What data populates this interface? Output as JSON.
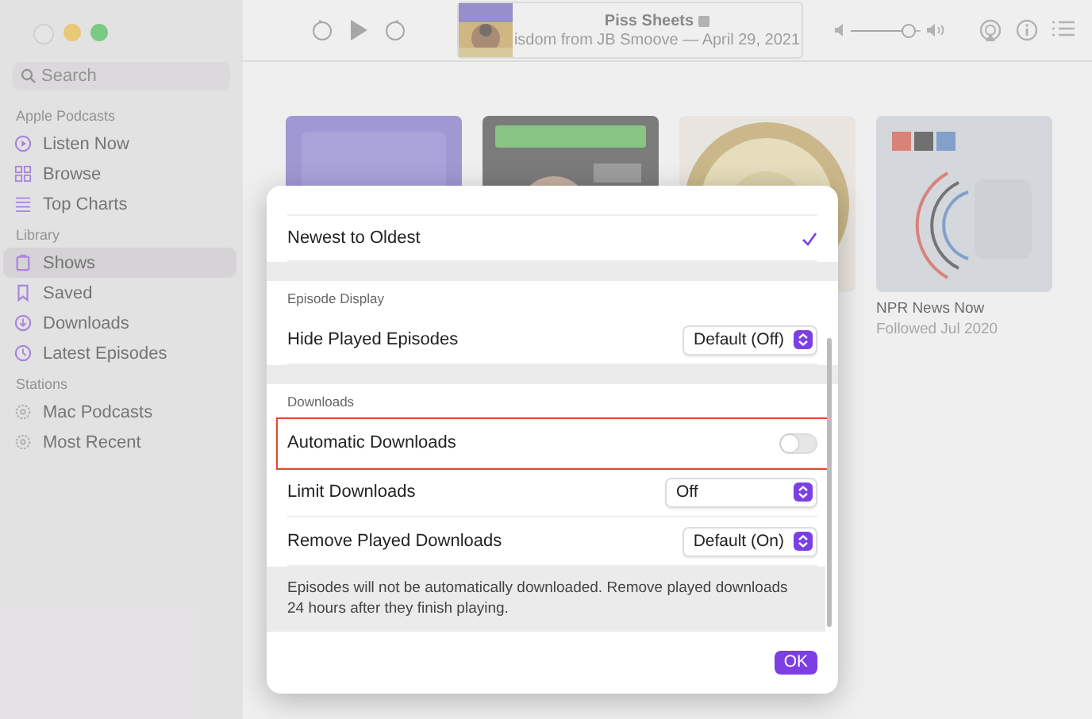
{
  "toolbar": {
    "now_playing": {
      "title": "Piss Sheets",
      "subtitle": "isdom from JB Smoove — April 29, 2021"
    },
    "volume": {
      "level": 0.85
    }
  },
  "sidebar": {
    "search": {
      "placeholder": "Search"
    },
    "sections": [
      {
        "title": "Apple Podcasts",
        "items": [
          {
            "label": "Listen Now",
            "selected": false
          },
          {
            "label": "Browse",
            "selected": false
          },
          {
            "label": "Top Charts",
            "selected": false
          }
        ]
      },
      {
        "title": "Library",
        "items": [
          {
            "label": "Shows",
            "selected": true
          },
          {
            "label": "Saved",
            "selected": false
          },
          {
            "label": "Downloads",
            "selected": false
          },
          {
            "label": "Latest Episodes",
            "selected": false
          }
        ]
      },
      {
        "title": "Stations",
        "items": [
          {
            "label": "Mac Podcasts",
            "selected": false
          },
          {
            "label": "Most Recent",
            "selected": false
          }
        ]
      }
    ]
  },
  "shows": [
    {
      "kind": "picture"
    },
    {
      "kind": "picture"
    },
    {
      "kind": "picture"
    },
    {
      "kind": "picture",
      "title": "NPR News Now",
      "subtitle": "Followed Jul 2020"
    }
  ],
  "dialog": {
    "rows": [
      {
        "kind": "blank"
      },
      {
        "kind": "check",
        "label": "Newest to Oldest",
        "checked": true
      },
      {
        "kind": "gap"
      },
      {
        "kind": "header",
        "label": "Episode Display"
      },
      {
        "kind": "popup",
        "label": "Hide Played Episodes",
        "value": "Default (Off)"
      },
      {
        "kind": "gap"
      },
      {
        "kind": "header",
        "label": "Downloads"
      },
      {
        "kind": "toggle",
        "label": "Automatic Downloads",
        "on": false,
        "highlighted": true
      },
      {
        "kind": "popup",
        "label": "Limit Downloads",
        "value": "Off"
      },
      {
        "kind": "popup",
        "label": "Remove Played Downloads",
        "value": "Default (On)"
      },
      {
        "kind": "note",
        "label": "Episodes will not be automatically downloaded. Remove played downloads 24 hours after they finish playing."
      }
    ],
    "button": "OK"
  }
}
